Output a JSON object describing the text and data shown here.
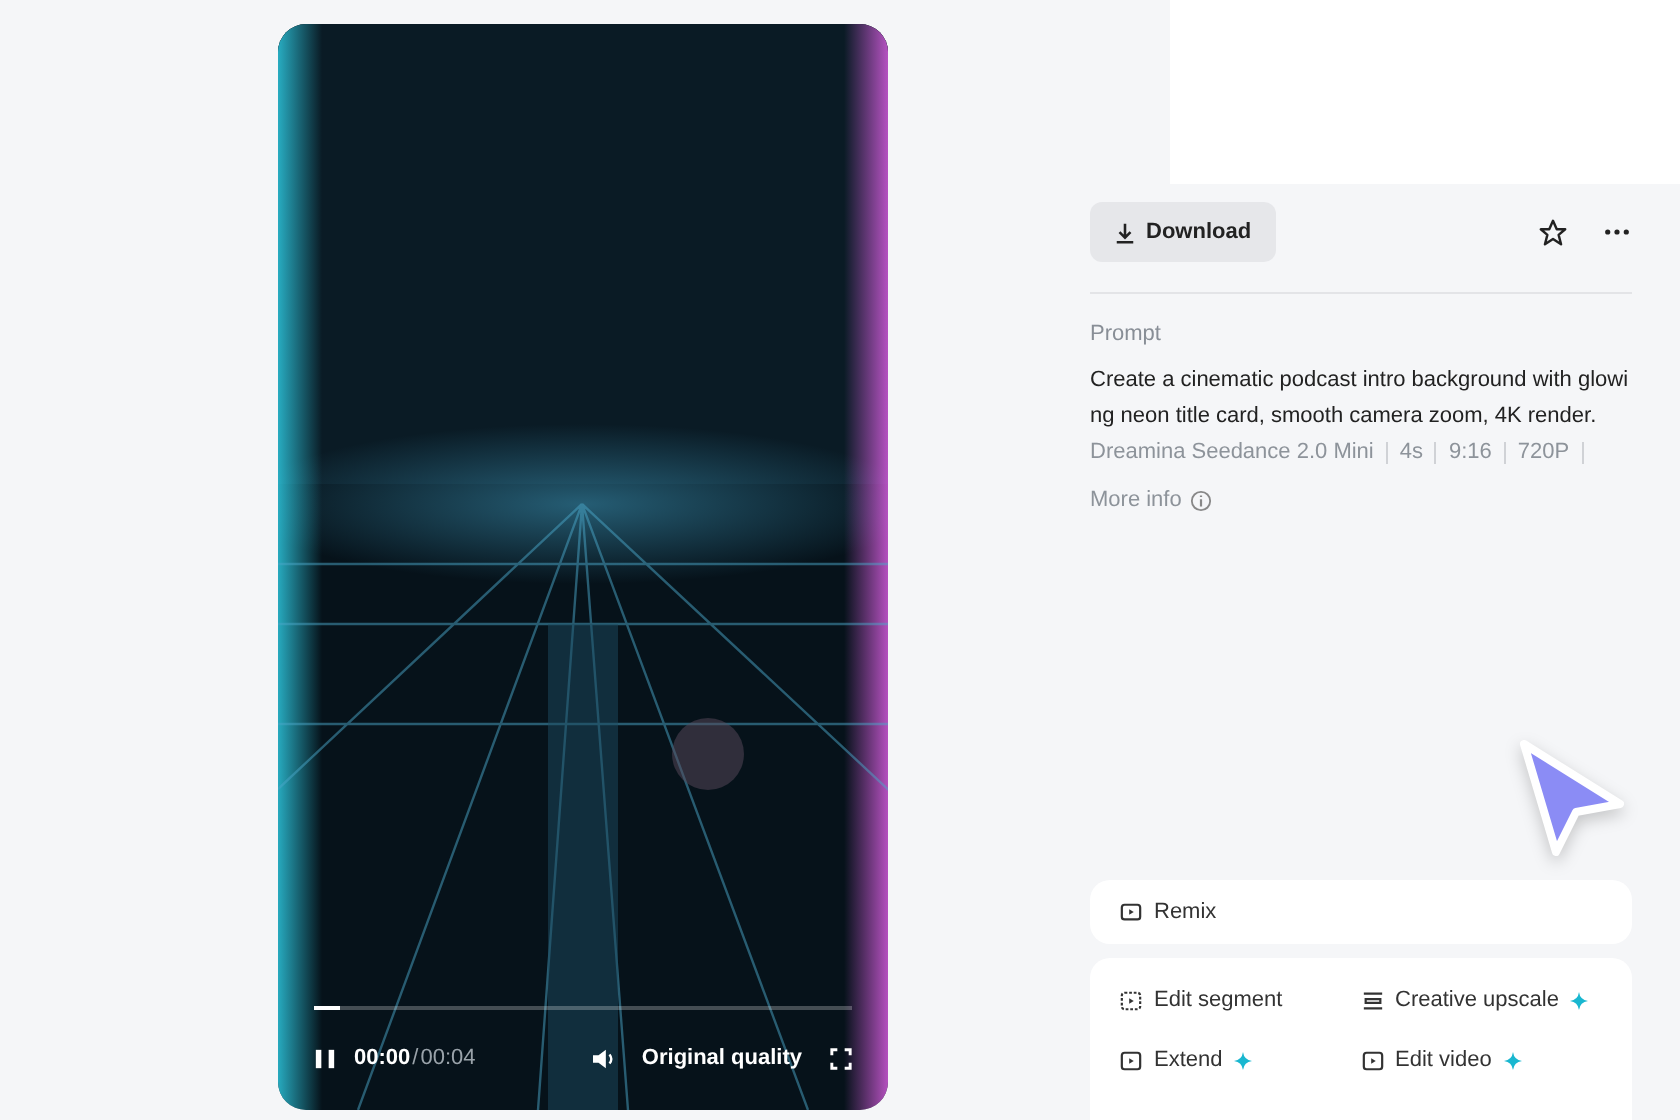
{
  "player": {
    "progress": {
      "level": 0.05
    },
    "playing": true,
    "current_time": "00:00",
    "separator": "/",
    "duration": "00:04",
    "quality": "Original quality"
  },
  "toolbar": {
    "download": "Download",
    "favorited": false
  },
  "prompt": {
    "label": "Prompt",
    "text": "Create a cinematic podcast intro background with glowing neon title card, smooth camera zoom, 4K render.",
    "meta": [
      "Dreamina Seedance 2.0 Mini",
      "4s",
      "9:16",
      "720P"
    ],
    "more_info": "More info"
  },
  "remix": {
    "label": "Remix"
  },
  "actions": [
    {
      "label": "Edit segment",
      "premium": false
    },
    {
      "label": "Creative upscale",
      "premium": true
    },
    {
      "label": "Extend",
      "premium": true
    },
    {
      "label": "Edit video",
      "premium": true
    }
  ]
}
